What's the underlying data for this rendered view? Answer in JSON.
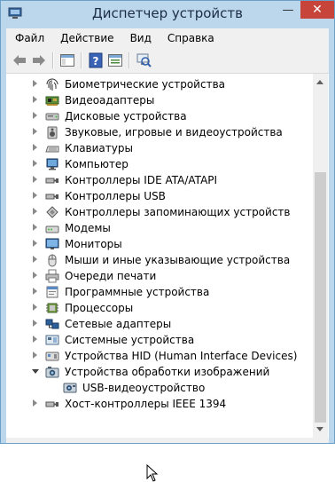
{
  "window": {
    "title": "Диспетчер устройств",
    "minimize_glyph": "—",
    "close_glyph": "✕"
  },
  "menu": [
    {
      "label": "Файл"
    },
    {
      "label": "Действие"
    },
    {
      "label": "Вид"
    },
    {
      "label": "Справка"
    }
  ],
  "toolbar": {
    "buttons": [
      "back-arrow-icon",
      "forward-arrow-icon",
      "show-hide-console-tree-icon",
      "help-icon",
      "properties-icon",
      "scan-hardware-icon"
    ]
  },
  "tree": {
    "rows": [
      {
        "label": "Биометрические устройства",
        "icon": "fingerprint-icon",
        "state": "collapsed"
      },
      {
        "label": "Видеоадаптеры",
        "icon": "display-adapter-icon",
        "state": "collapsed"
      },
      {
        "label": "Дисковые устройства",
        "icon": "disk-drive-icon",
        "state": "collapsed"
      },
      {
        "label": "Звуковые, игровые и видеоустройства",
        "icon": "speaker-icon",
        "state": "collapsed"
      },
      {
        "label": "Клавиатуры",
        "icon": "keyboard-icon",
        "state": "collapsed"
      },
      {
        "label": "Компьютер",
        "icon": "computer-icon",
        "state": "collapsed"
      },
      {
        "label": "Контроллеры IDE ATA/ATAPI",
        "icon": "ide-controller-icon",
        "state": "collapsed"
      },
      {
        "label": "Контроллеры USB",
        "icon": "usb-controller-icon",
        "state": "collapsed"
      },
      {
        "label": "Контроллеры запоминающих устройств",
        "icon": "storage-controller-icon",
        "state": "collapsed"
      },
      {
        "label": "Модемы",
        "icon": "modem-icon",
        "state": "collapsed"
      },
      {
        "label": "Мониторы",
        "icon": "monitor-icon",
        "state": "collapsed"
      },
      {
        "label": "Мыши и иные указывающие устройства",
        "icon": "mouse-icon",
        "state": "collapsed"
      },
      {
        "label": "Очереди печати",
        "icon": "printer-icon",
        "state": "collapsed"
      },
      {
        "label": "Программные устройства",
        "icon": "software-device-icon",
        "state": "collapsed"
      },
      {
        "label": "Процессоры",
        "icon": "processor-icon",
        "state": "collapsed"
      },
      {
        "label": "Сетевые адаптеры",
        "icon": "network-adapter-icon",
        "state": "collapsed"
      },
      {
        "label": "Системные устройства",
        "icon": "system-device-icon",
        "state": "collapsed"
      },
      {
        "label": "Устройства HID (Human Interface Devices)",
        "icon": "hid-icon",
        "state": "collapsed"
      },
      {
        "label": "Устройства обработки изображений",
        "icon": "camera-icon",
        "state": "expanded"
      },
      {
        "label": "USB-видеоустройство",
        "icon": "webcam-icon",
        "state": "child"
      },
      {
        "label": "Хост-контроллеры IEEE 1394",
        "icon": "ieee1394-icon",
        "state": "collapsed"
      }
    ]
  },
  "colors": {
    "titlebar": "#bcd6ec",
    "close_button": "#c7443a",
    "content_bg": "#ffffff",
    "chrome_bg": "#f0f0f0"
  }
}
